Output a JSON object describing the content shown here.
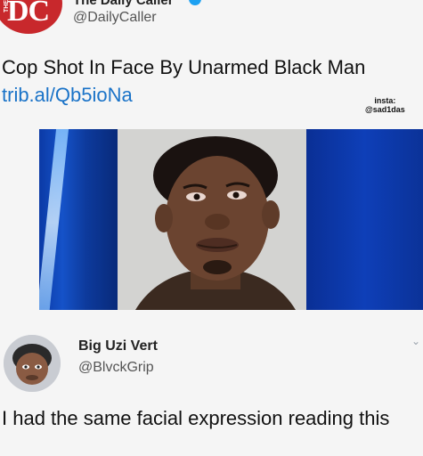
{
  "tweet": {
    "avatar_logo_text": "DC",
    "avatar_logo_small": "THE",
    "display_name": "The Daily Caller",
    "handle": "@DailyCaller",
    "text": "Cop Shot In Face By Unarmed Black Man ",
    "link": "trib.al/Qb5ioNa",
    "media_alt": "mugshot-photo"
  },
  "watermark": {
    "line1": "insta:",
    "line2": "@sad1das"
  },
  "reply": {
    "display_name": "Big Uzi Vert",
    "handle": "@BlvckGrip",
    "text": "I had the same facial expression reading this",
    "menu_icon": "chevron-down-icon"
  }
}
